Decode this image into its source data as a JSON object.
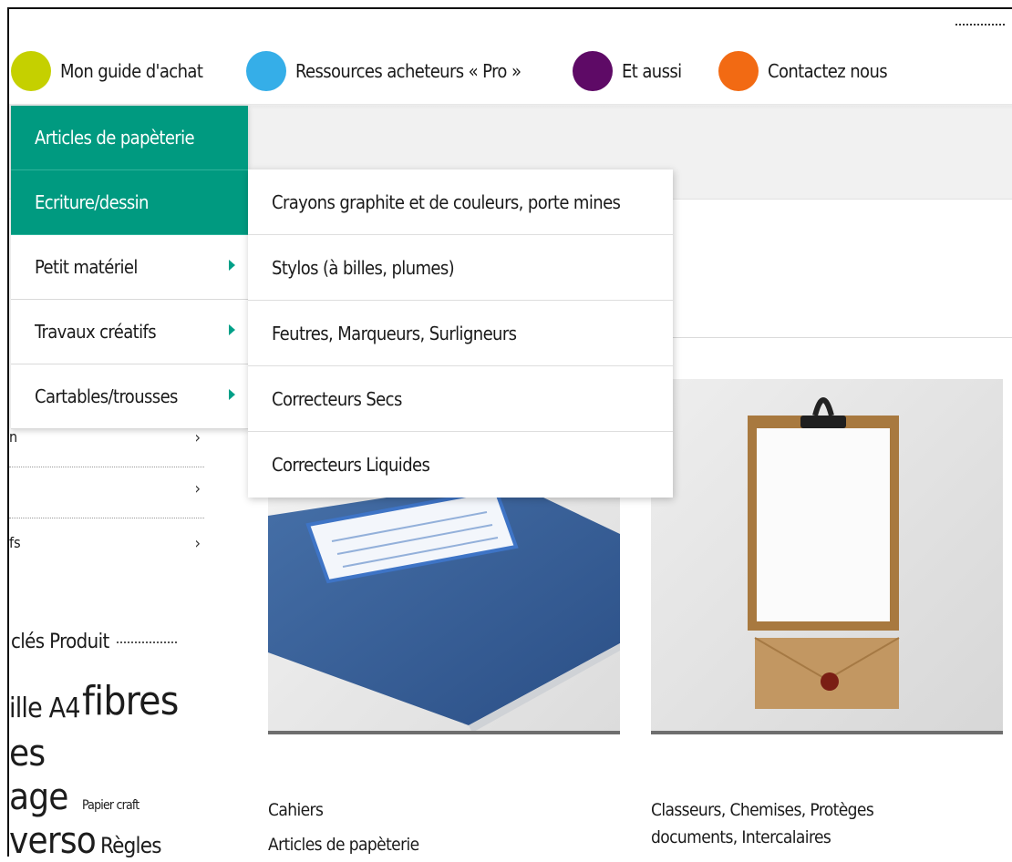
{
  "nav": {
    "items": [
      {
        "label": "Mon guide d'achat",
        "color": "#c5d000"
      },
      {
        "label": "Ressources acheteurs « Pro »",
        "color": "#35aee8"
      },
      {
        "label": "Et aussi",
        "color": "#5e0a66"
      },
      {
        "label": "Contactez nous",
        "color": "#f26a13"
      }
    ]
  },
  "menu": {
    "level1": [
      {
        "label": "Articles de papèterie"
      },
      {
        "label": "Ecriture/dessin"
      },
      {
        "label": "Petit matériel"
      },
      {
        "label": "Travaux créatifs"
      },
      {
        "label": "Cartables/trousses"
      }
    ],
    "level2": [
      "Crayons graphite et de couleurs, porte mines",
      "Stylos (à billes, plumes)",
      "Feutres, Marqueurs, Surligneurs",
      "Correcteurs Secs",
      "Correcteurs Liquides"
    ]
  },
  "sidebar": {
    "rows": [
      {
        "text": "n",
        "chevron": "›"
      },
      {
        "text": "",
        "chevron": "›"
      },
      {
        "text": "fs",
        "chevron": "›"
      }
    ],
    "tags_title": "clés Produit",
    "tags": [
      "ille A4",
      "fibres",
      "es",
      "age",
      "Papier craft",
      "verso",
      "Règles"
    ]
  },
  "cards": [
    {
      "title": "Cahiers",
      "subtitle": "Articles de papèterie"
    },
    {
      "title": "Classeurs, Chemises, Protèges documents, Intercalaires",
      "subtitle": ""
    }
  ],
  "colors": {
    "menu_active": "#009a80",
    "menu_arrow": "#00a088"
  }
}
